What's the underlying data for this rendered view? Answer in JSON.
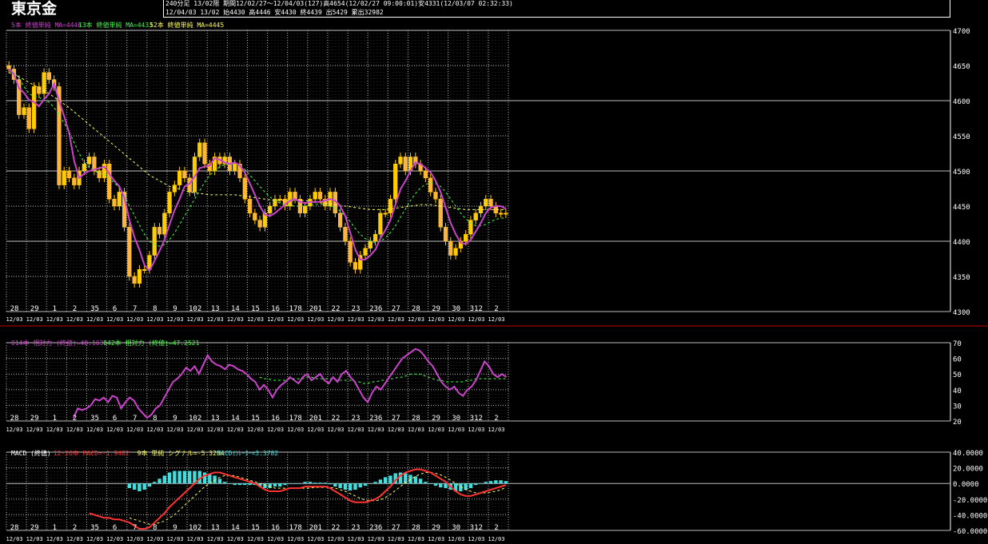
{
  "header": {
    "title": "東京金",
    "line1": "240分足 13/02限  期間12/02/27～12/04/03(127)高4654(12/02/27 09:00:01)安4331(12/03/07 02:32:33)",
    "line2": "12/04/03 13/02 始4430 高4446 安4430 終4439 出5429 累出32982"
  },
  "colors": {
    "up": "#ffcc00",
    "down": "#ffb340",
    "ma5": "#cc44cc",
    "ma13": "#44ff44",
    "ma52": "#ffff66",
    "macd": "#ff3333",
    "signal": "#ffff66",
    "osc": "#44dddd",
    "grid": "#bbbbbb",
    "divider": "#cc0000"
  },
  "x_axis": {
    "date_labels": [
      "28",
      "29",
      "1",
      "2",
      "35",
      "6",
      "7",
      "8",
      "9",
      "102",
      "13",
      "14",
      "15",
      "16",
      "178",
      "201",
      "22",
      "23",
      "236",
      "27",
      "28",
      "29",
      "30",
      "312",
      "2"
    ],
    "session_label": "12/03"
  },
  "chart_data": [
    {
      "type": "candlestick",
      "panel": "price",
      "legend": [
        {
          "text": "5本 終値単純 MA=4446",
          "color": "#cc44cc"
        },
        {
          "text": "13本 終値単純 MA=4433",
          "color": "#44ff44"
        },
        {
          "text": "52本 終値単純 MA=4445",
          "color": "#ffff66"
        }
      ],
      "ylim": [
        4300,
        4700
      ],
      "yticks": [
        4300,
        4350,
        4400,
        4450,
        4500,
        4550,
        4600,
        4650,
        4700
      ],
      "closes": [
        4645,
        4630,
        4580,
        4590,
        4560,
        4620,
        4610,
        4640,
        4630,
        4620,
        4480,
        4500,
        4490,
        4480,
        4500,
        4510,
        4520,
        4500,
        4490,
        4510,
        4460,
        4450,
        4470,
        4420,
        4350,
        4340,
        4360,
        4360,
        4380,
        4420,
        4410,
        4440,
        4470,
        4480,
        4500,
        4490,
        4470,
        4520,
        4540,
        4510,
        4500,
        4520,
        4510,
        4520,
        4500,
        4510,
        4490,
        4460,
        4440,
        4430,
        4420,
        4440,
        4450,
        4460,
        4460,
        4450,
        4470,
        4460,
        4440,
        4450,
        4460,
        4470,
        4460,
        4450,
        4470,
        4440,
        4420,
        4400,
        4370,
        4360,
        4380,
        4390,
        4400,
        4410,
        4440,
        4440,
        4460,
        4510,
        4520,
        4500,
        4520,
        4510,
        4500,
        4490,
        4470,
        4460,
        4420,
        4400,
        4380,
        4390,
        4400,
        4410,
        4430,
        4440,
        4450,
        4460,
        4450,
        4440,
        4440,
        4439
      ],
      "ma5": [
        4645,
        4638,
        4618,
        4611,
        4601,
        4598,
        4592,
        4602,
        4610,
        4624,
        4600,
        4578,
        4554,
        4514,
        4490,
        4496,
        4500,
        4502,
        4504,
        4506,
        4496,
        4486,
        4478,
        4462,
        4430,
        4406,
        4388,
        4366,
        4358,
        4372,
        4386,
        4402,
        4424,
        4444,
        4460,
        4478,
        4482,
        4492,
        4504,
        4506,
        4508,
        4518,
        4516,
        4512,
        4510,
        4512,
        4508,
        4498,
        4482,
        4466,
        4450,
        4438,
        4436,
        4440,
        4446,
        4452,
        4458,
        4460,
        4456,
        4454,
        4456,
        4456,
        4456,
        4458,
        4460,
        4458,
        4450,
        4436,
        4412,
        4388,
        4374,
        4374,
        4380,
        4388,
        4404,
        4416,
        4430,
        4452,
        4474,
        4486,
        4500,
        4512,
        4510,
        4504,
        4498,
        4486,
        4470,
        4448,
        4426,
        4410,
        4398,
        4396,
        4402,
        4414,
        4426,
        4440,
        4448,
        4450,
        4450,
        4446
      ],
      "ma13": [
        4645,
        4641,
        4632,
        4620,
        4610,
        4606,
        4605,
        4600,
        4598,
        4590,
        4580,
        4568,
        4556,
        4540,
        4525,
        4512,
        4505,
        4500,
        4497,
        4495,
        4490,
        4483,
        4476,
        4465,
        4450,
        4437,
        4423,
        4410,
        4400,
        4395,
        4393,
        4395,
        4402,
        4412,
        4424,
        4436,
        4448,
        4460,
        4472,
        4484,
        4494,
        4500,
        4506,
        4509,
        4510,
        4510,
        4508,
        4502,
        4494,
        4486,
        4478,
        4470,
        4463,
        4458,
        4454,
        4452,
        4451,
        4450,
        4450,
        4450,
        4451,
        4452,
        4453,
        4452,
        4450,
        4447,
        4443,
        4436,
        4428,
        4418,
        4410,
        4404,
        4400,
        4398,
        4400,
        4405,
        4412,
        4422,
        4434,
        4446,
        4458,
        4468,
        4476,
        4481,
        4483,
        4482,
        4478,
        4470,
        4460,
        4450,
        4440,
        4432,
        4426,
        4422,
        4422,
        4424,
        4428,
        4431,
        4433,
        4433
      ],
      "ma52": [
        4640,
        4637,
        4634,
        4630,
        4626,
        4622,
        4618,
        4614,
        4610,
        4605,
        4600,
        4595,
        4590,
        4584,
        4578,
        4572,
        4566,
        4560,
        4554,
        4548,
        4542,
        4536,
        4530,
        4524,
        4518,
        4512,
        4506,
        4500,
        4494,
        4490,
        4486,
        4482,
        4478,
        4476,
        4474,
        4472,
        4470,
        4469,
        4468,
        4467,
        4466,
        4466,
        4466,
        4466,
        4466,
        4466,
        4465,
        4464,
        4463,
        4462,
        4461,
        4460,
        4459,
        4458,
        4458,
        4458,
        4458,
        4458,
        4458,
        4458,
        4457,
        4456,
        4455,
        4454,
        4453,
        4452,
        4451,
        4450,
        4449,
        4448,
        4447,
        4446,
        4445,
        4445,
        4445,
        4445,
        4446,
        4447,
        4448,
        4449,
        4450,
        4451,
        4452,
        4452,
        4452,
        4451,
        4450,
        4449,
        4448,
        4447,
        4446,
        4445,
        4445,
        4445,
        4445,
        4445,
        4445,
        4445,
        4445,
        4445
      ]
    },
    {
      "type": "line",
      "panel": "rsi",
      "legend": [
        {
          "text": "014本 相対力 (終値)=48.1636",
          "color": "#cc44cc"
        },
        {
          "text": "042本 相対力 (終値)=47.2521",
          "color": "#44ff44"
        }
      ],
      "ylim": [
        20,
        70
      ],
      "yticks": [
        20,
        30,
        40,
        50,
        60,
        70
      ],
      "rsi14": [
        null,
        null,
        null,
        null,
        null,
        null,
        null,
        null,
        null,
        null,
        null,
        null,
        null,
        null,
        null,
        22,
        28,
        27,
        28,
        30,
        34,
        33,
        35,
        32,
        36,
        35,
        28,
        32,
        35,
        33,
        28,
        25,
        22,
        24,
        28,
        30,
        35,
        40,
        45,
        47,
        50,
        54,
        52,
        55,
        50,
        56,
        62,
        58,
        56,
        55,
        53,
        56,
        55,
        53,
        52,
        50,
        47,
        45,
        40,
        43,
        40,
        35,
        40,
        43,
        45,
        48,
        46,
        44,
        48,
        50,
        46,
        48,
        50,
        46,
        44,
        48,
        45,
        50,
        52,
        48,
        45,
        40,
        35,
        32,
        38,
        42,
        40,
        44,
        48,
        52,
        56,
        60,
        62,
        64,
        66,
        65,
        62,
        58,
        55,
        50,
        45,
        42,
        40,
        42,
        38,
        36,
        40,
        42,
        46,
        52,
        58,
        55,
        50,
        48,
        50,
        48
      ],
      "rsi42": [
        null,
        null,
        null,
        null,
        null,
        null,
        null,
        null,
        null,
        null,
        null,
        null,
        null,
        null,
        null,
        null,
        null,
        null,
        null,
        null,
        null,
        null,
        null,
        null,
        null,
        null,
        null,
        null,
        null,
        null,
        null,
        null,
        null,
        null,
        null,
        null,
        null,
        null,
        null,
        null,
        null,
        null,
        null,
        null,
        null,
        null,
        null,
        null,
        null,
        null,
        null,
        null,
        null,
        null,
        null,
        null,
        null,
        null,
        48,
        47,
        47,
        46,
        46,
        46,
        46,
        47,
        47,
        47,
        47,
        48,
        48,
        47,
        47,
        47,
        47,
        47,
        46,
        46,
        46,
        46,
        45,
        45,
        44,
        44,
        45,
        45,
        46,
        46,
        47,
        47,
        48,
        48,
        49,
        50,
        50,
        50,
        49,
        48,
        47,
        46,
        46,
        45,
        45,
        45,
        45,
        45,
        46,
        46,
        47,
        47,
        47,
        47,
        47,
        47,
        47,
        47
      ]
    },
    {
      "type": "bar+line",
      "panel": "macd",
      "legend": [
        {
          "text": "MACD (終値)",
          "color": "#ffffff"
        },
        {
          "text": "12-26本 MACD=-1.9482",
          "color": "#ff3333"
        },
        {
          "text": "9本 単純 シグナル=-5.3264",
          "color": "#ffff66"
        },
        {
          "text": "MACDｵｼﾚｰﾀｰ=3.3782",
          "color": "#44dddd"
        }
      ],
      "ylim": [
        -60,
        40
      ],
      "yticks": [
        "40.0000",
        "20.0000",
        "0.0000",
        "-20.0000",
        "-40.0000",
        "-60.0000"
      ],
      "macd": [
        null,
        null,
        null,
        null,
        null,
        null,
        null,
        null,
        null,
        null,
        null,
        null,
        null,
        null,
        null,
        null,
        -38,
        -40,
        -42,
        -44,
        -44,
        -46,
        -46,
        -48,
        -50,
        -54,
        -58,
        -58,
        -56,
        -50,
        -44,
        -38,
        -30,
        -24,
        -18,
        -12,
        -6,
        0,
        6,
        10,
        12,
        14,
        14,
        12,
        10,
        8,
        6,
        4,
        2,
        0,
        -4,
        -8,
        -10,
        -10,
        -10,
        -8,
        -6,
        -6,
        -6,
        -4,
        -4,
        -4,
        -4,
        -4,
        -6,
        -10,
        -14,
        -18,
        -22,
        -24,
        -24,
        -24,
        -22,
        -20,
        -16,
        -10,
        -4,
        4,
        10,
        14,
        16,
        18,
        18,
        16,
        14,
        10,
        6,
        2,
        -4,
        -10,
        -14,
        -16,
        -16,
        -14,
        -12,
        -10,
        -8,
        -6,
        -4,
        -2
      ],
      "signal": [
        null,
        null,
        null,
        null,
        null,
        null,
        null,
        null,
        null,
        null,
        null,
        null,
        null,
        null,
        null,
        null,
        null,
        null,
        null,
        null,
        null,
        null,
        null,
        null,
        -44,
        -46,
        -48,
        -50,
        -52,
        -52,
        -50,
        -48,
        -44,
        -40,
        -34,
        -28,
        -22,
        -16,
        -10,
        -4,
        0,
        4,
        8,
        10,
        10,
        10,
        8,
        6,
        4,
        2,
        0,
        -2,
        -4,
        -6,
        -6,
        -6,
        -6,
        -6,
        -6,
        -6,
        -6,
        -5,
        -5,
        -5,
        -5,
        -6,
        -8,
        -10,
        -13,
        -16,
        -19,
        -21,
        -22,
        -22,
        -21,
        -18,
        -14,
        -9,
        -4,
        1,
        5,
        9,
        12,
        14,
        14,
        13,
        11,
        8,
        4,
        0,
        -4,
        -8,
        -10,
        -12,
        -12,
        -12,
        -11,
        -10,
        -8,
        -5
      ],
      "osc": [
        null,
        null,
        null,
        null,
        null,
        null,
        null,
        null,
        null,
        null,
        null,
        null,
        null,
        null,
        null,
        null,
        null,
        null,
        null,
        null,
        null,
        null,
        null,
        null,
        -6,
        -8,
        -10,
        -8,
        -4,
        2,
        6,
        10,
        14,
        16,
        16,
        16,
        16,
        16,
        16,
        14,
        12,
        10,
        6,
        2,
        0,
        -2,
        -2,
        -2,
        -2,
        -2,
        -4,
        -6,
        -6,
        -4,
        -4,
        -2,
        0,
        0,
        0,
        2,
        2,
        1,
        1,
        1,
        -1,
        -4,
        -6,
        -8,
        -9,
        -8,
        -5,
        -3,
        0,
        2,
        5,
        8,
        10,
        13,
        14,
        13,
        11,
        9,
        6,
        2,
        0,
        -3,
        -5,
        -6,
        -8,
        -10,
        -10,
        -8,
        -6,
        -2,
        0,
        2,
        3,
        4,
        4,
        3
      ]
    }
  ]
}
